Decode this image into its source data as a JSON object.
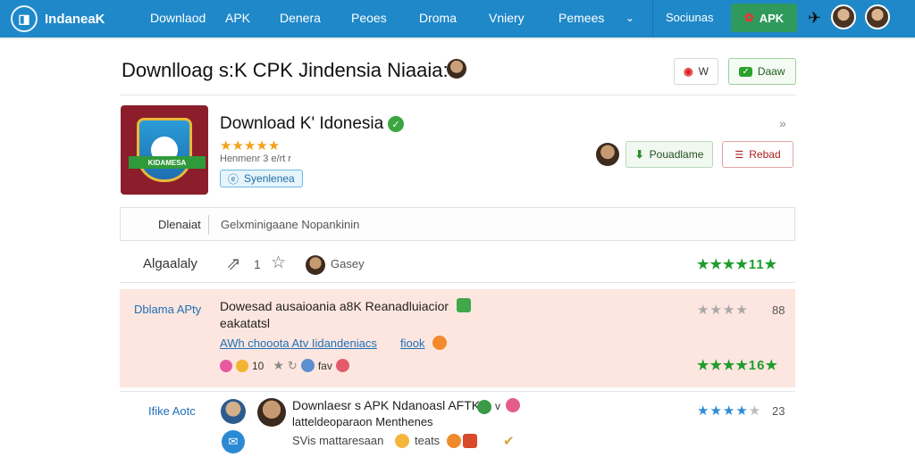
{
  "nav": {
    "logo_text": "IndaneaK",
    "items": [
      "Downlaod",
      "APK",
      "Denera",
      "Peoes",
      "Droma",
      "Vniery",
      "Pemees"
    ],
    "search": "Sociunas",
    "apk_button": "APK"
  },
  "header": {
    "title": "Downlloag s:K CPK Jindensia Niaaia:",
    "btn_report": "W",
    "btn_save": "Daaw"
  },
  "app": {
    "name": "Download K' Idonesia",
    "icon_banner": "KIDAMESA",
    "stars": "★★★★★",
    "subtitle": "Henmenr 3 e/rt r",
    "tag": "Syenlenea",
    "btn_download": "Pouadlame",
    "btn_reload": "Rebad"
  },
  "meta": {
    "label": "Dlenaiat",
    "value": "Gelxminigaane Nopankinin"
  },
  "actions": {
    "label": "Algaalaly",
    "count": "1",
    "user": "Gasey",
    "rating_stars": "★★★★",
    "rating_score": "11",
    "rating_end": "★"
  },
  "review1": {
    "tag": "Dblama APty",
    "line1": "Dowesad ausaioania a8K Reanadluiacior",
    "line2": "eakatatsl",
    "link1": "AWh chooota Atv Iidandeniacs",
    "link2": "fiook",
    "count": "10",
    "reaction": "fav",
    "gray_stars": "★★★★",
    "gray_score": "88",
    "green_stars": "★★★★",
    "green_score": "16"
  },
  "review2": {
    "tag": "Ifike Aotc",
    "line1": "Downlaesr s APK Ndanoasl AFTK",
    "line2": "latteldeoparaon Menthenes",
    "line3": "SVis mattaresaan",
    "line3b": "teats",
    "blue_stars": "★★★★",
    "blue_off": "★",
    "blue_score": "23"
  },
  "colors": {
    "nav_bg": "#1f88c9",
    "accent_green": "#1f9c2e",
    "review_highlight": "#fde6df",
    "brand_blue": "#1e70b7"
  }
}
